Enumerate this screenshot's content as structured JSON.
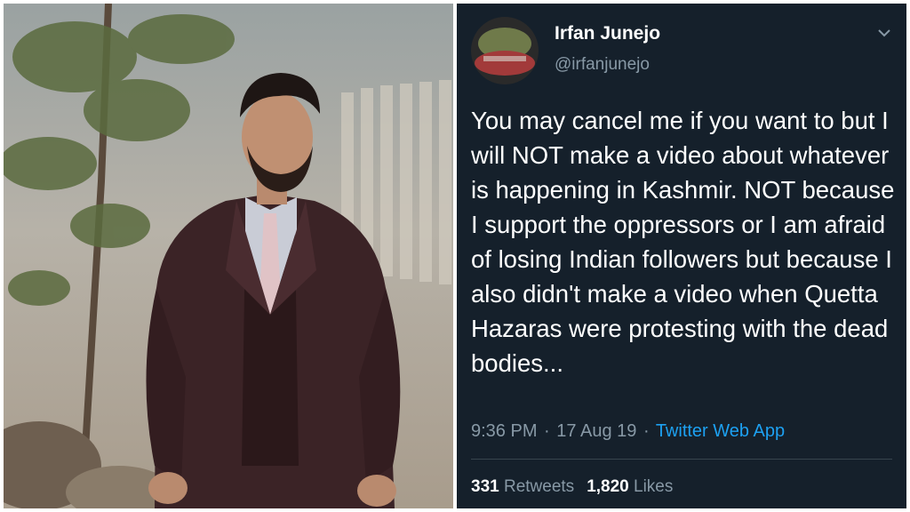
{
  "photo": {
    "icon": "man-in-suit-photo"
  },
  "tweet": {
    "display_name": "Irfan Junejo",
    "handle": "@irfanjunejo",
    "text": "You may cancel me if you want to but I will NOT make a video about whatever is happening in Kashmir. NOT because I support the oppressors or I am afraid of losing Indian followers but because I also didn't make a video when Quetta Hazaras were protesting with the dead bodies...",
    "time": "9:36 PM",
    "date": "17 Aug 19",
    "separator": "·",
    "source": "Twitter Web App",
    "retweets_count": "331",
    "retweets_label": "Retweets",
    "likes_count": "1,820",
    "likes_label": "Likes",
    "colors": {
      "background": "#15202b",
      "secondary_text": "#8899a6",
      "link": "#1da1f2"
    }
  }
}
